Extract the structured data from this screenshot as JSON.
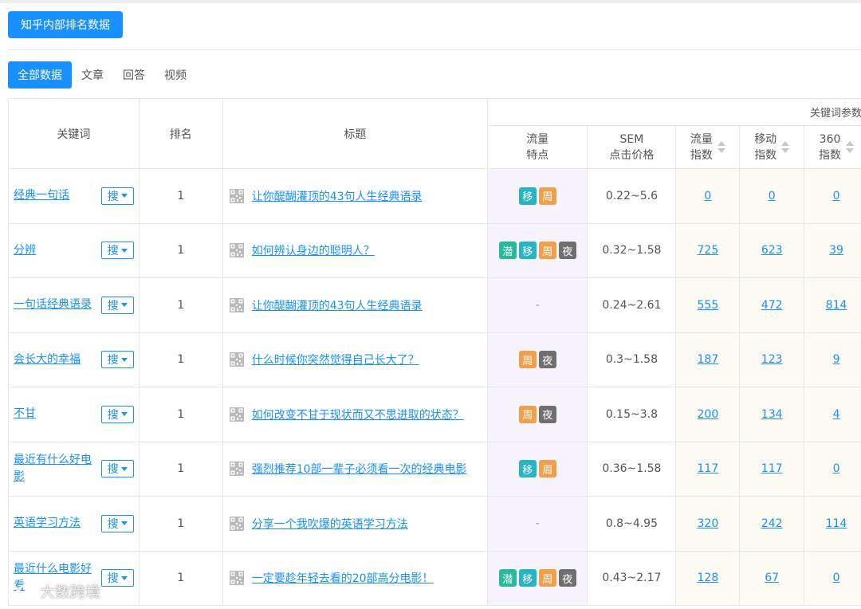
{
  "header": {
    "main_button": "知乎内部排名数据"
  },
  "tabs": [
    {
      "label": "全部数据",
      "active": true
    },
    {
      "label": "文章",
      "active": false
    },
    {
      "label": "回答",
      "active": false
    },
    {
      "label": "视频",
      "active": false
    }
  ],
  "table": {
    "group_header": "关键词参数",
    "columns": {
      "keyword": "关键词",
      "rank": "排名",
      "title": "标题",
      "traffic_1": "流量",
      "traffic_2": "特点",
      "sem_1": "SEM",
      "sem_2": "点击价格",
      "flow_1": "流量",
      "flow_2": "指数",
      "mobile_1": "移动",
      "mobile_2": "指数",
      "s360_1": "360",
      "s360_2": "指数"
    },
    "search_label": "搜",
    "rows": [
      {
        "keyword": "经典一句话",
        "rank": "1",
        "title": "让你醍醐灌顶的43句人生经典语录",
        "badges": [
          "移",
          "周"
        ],
        "sem": "0.22~5.6",
        "flow": "0",
        "mobile": "0",
        "s360": "0"
      },
      {
        "keyword": "分辨",
        "rank": "1",
        "title": "如何辨认身边的聪明人？",
        "badges": [
          "潜",
          "移",
          "周",
          "夜"
        ],
        "sem": "0.32~1.58",
        "flow": "725",
        "mobile": "623",
        "s360": "39"
      },
      {
        "keyword": "一句话经典语录",
        "rank": "1",
        "title": "让你醍醐灌顶的43句人生经典语录",
        "badges": [],
        "sem": "0.24~2.61",
        "flow": "555",
        "mobile": "472",
        "s360": "814"
      },
      {
        "keyword": "会长大的幸福",
        "rank": "1",
        "title": "什么时候你突然觉得自己长大了？",
        "badges": [
          "周",
          "夜"
        ],
        "sem": "0.3~1.58",
        "flow": "187",
        "mobile": "123",
        "s360": "9"
      },
      {
        "keyword": "不甘",
        "rank": "1",
        "title": "如何改变不甘于现状而又不思进取的状态？",
        "badges": [
          "周",
          "夜"
        ],
        "sem": "0.15~3.8",
        "flow": "200",
        "mobile": "134",
        "s360": "4"
      },
      {
        "keyword": "最近有什么好电影",
        "rank": "1",
        "title": "强烈推荐10部一辈子必须看一次的经典电影",
        "badges": [
          "移",
          "周"
        ],
        "sem": "0.36~1.58",
        "flow": "117",
        "mobile": "117",
        "s360": "0"
      },
      {
        "keyword": "英语学习方法",
        "rank": "1",
        "title": "分享一个我吹爆的英语学习方法",
        "badges": [],
        "sem": "0.8~4.95",
        "flow": "320",
        "mobile": "242",
        "s360": "114"
      },
      {
        "keyword": "最近什么电影好看",
        "rank": "1",
        "title": "一定要趁年轻去看的20部高分电影！",
        "badges": [
          "潜",
          "移",
          "周",
          "夜"
        ],
        "sem": "0.43~2.17",
        "flow": "128",
        "mobile": "67",
        "s360": "0"
      }
    ],
    "empty_dash": "-"
  },
  "badge_colors": {
    "潜": "#26b99a",
    "移": "#26b5c4",
    "周": "#f0a04b",
    "夜": "#6f6f6f"
  },
  "watermark": {
    "text": "大数跨境"
  }
}
